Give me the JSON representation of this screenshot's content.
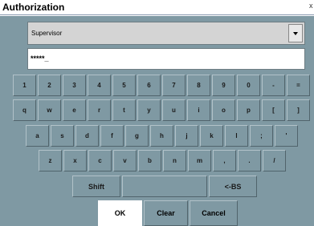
{
  "window": {
    "title": "Authorization",
    "close_glyph": "x"
  },
  "user_select": {
    "value": "Supervisor"
  },
  "password": {
    "value": "*****_"
  },
  "keyboard": {
    "row1": [
      "1",
      "2",
      "3",
      "4",
      "5",
      "6",
      "7",
      "8",
      "9",
      "0",
      "-",
      "="
    ],
    "row2": [
      "q",
      "w",
      "e",
      "r",
      "t",
      "y",
      "u",
      "i",
      "o",
      "p",
      "[",
      "]"
    ],
    "row3": [
      "a",
      "s",
      "d",
      "f",
      "g",
      "h",
      "j",
      "k",
      "l",
      ";",
      "'"
    ],
    "row4": [
      "z",
      "x",
      "c",
      "v",
      "b",
      "n",
      "m",
      ",",
      ".",
      "/"
    ],
    "shift": "Shift",
    "space": "",
    "backspace": "<-BS"
  },
  "actions": {
    "ok": "OK",
    "clear": "Clear",
    "cancel": "Cancel"
  }
}
